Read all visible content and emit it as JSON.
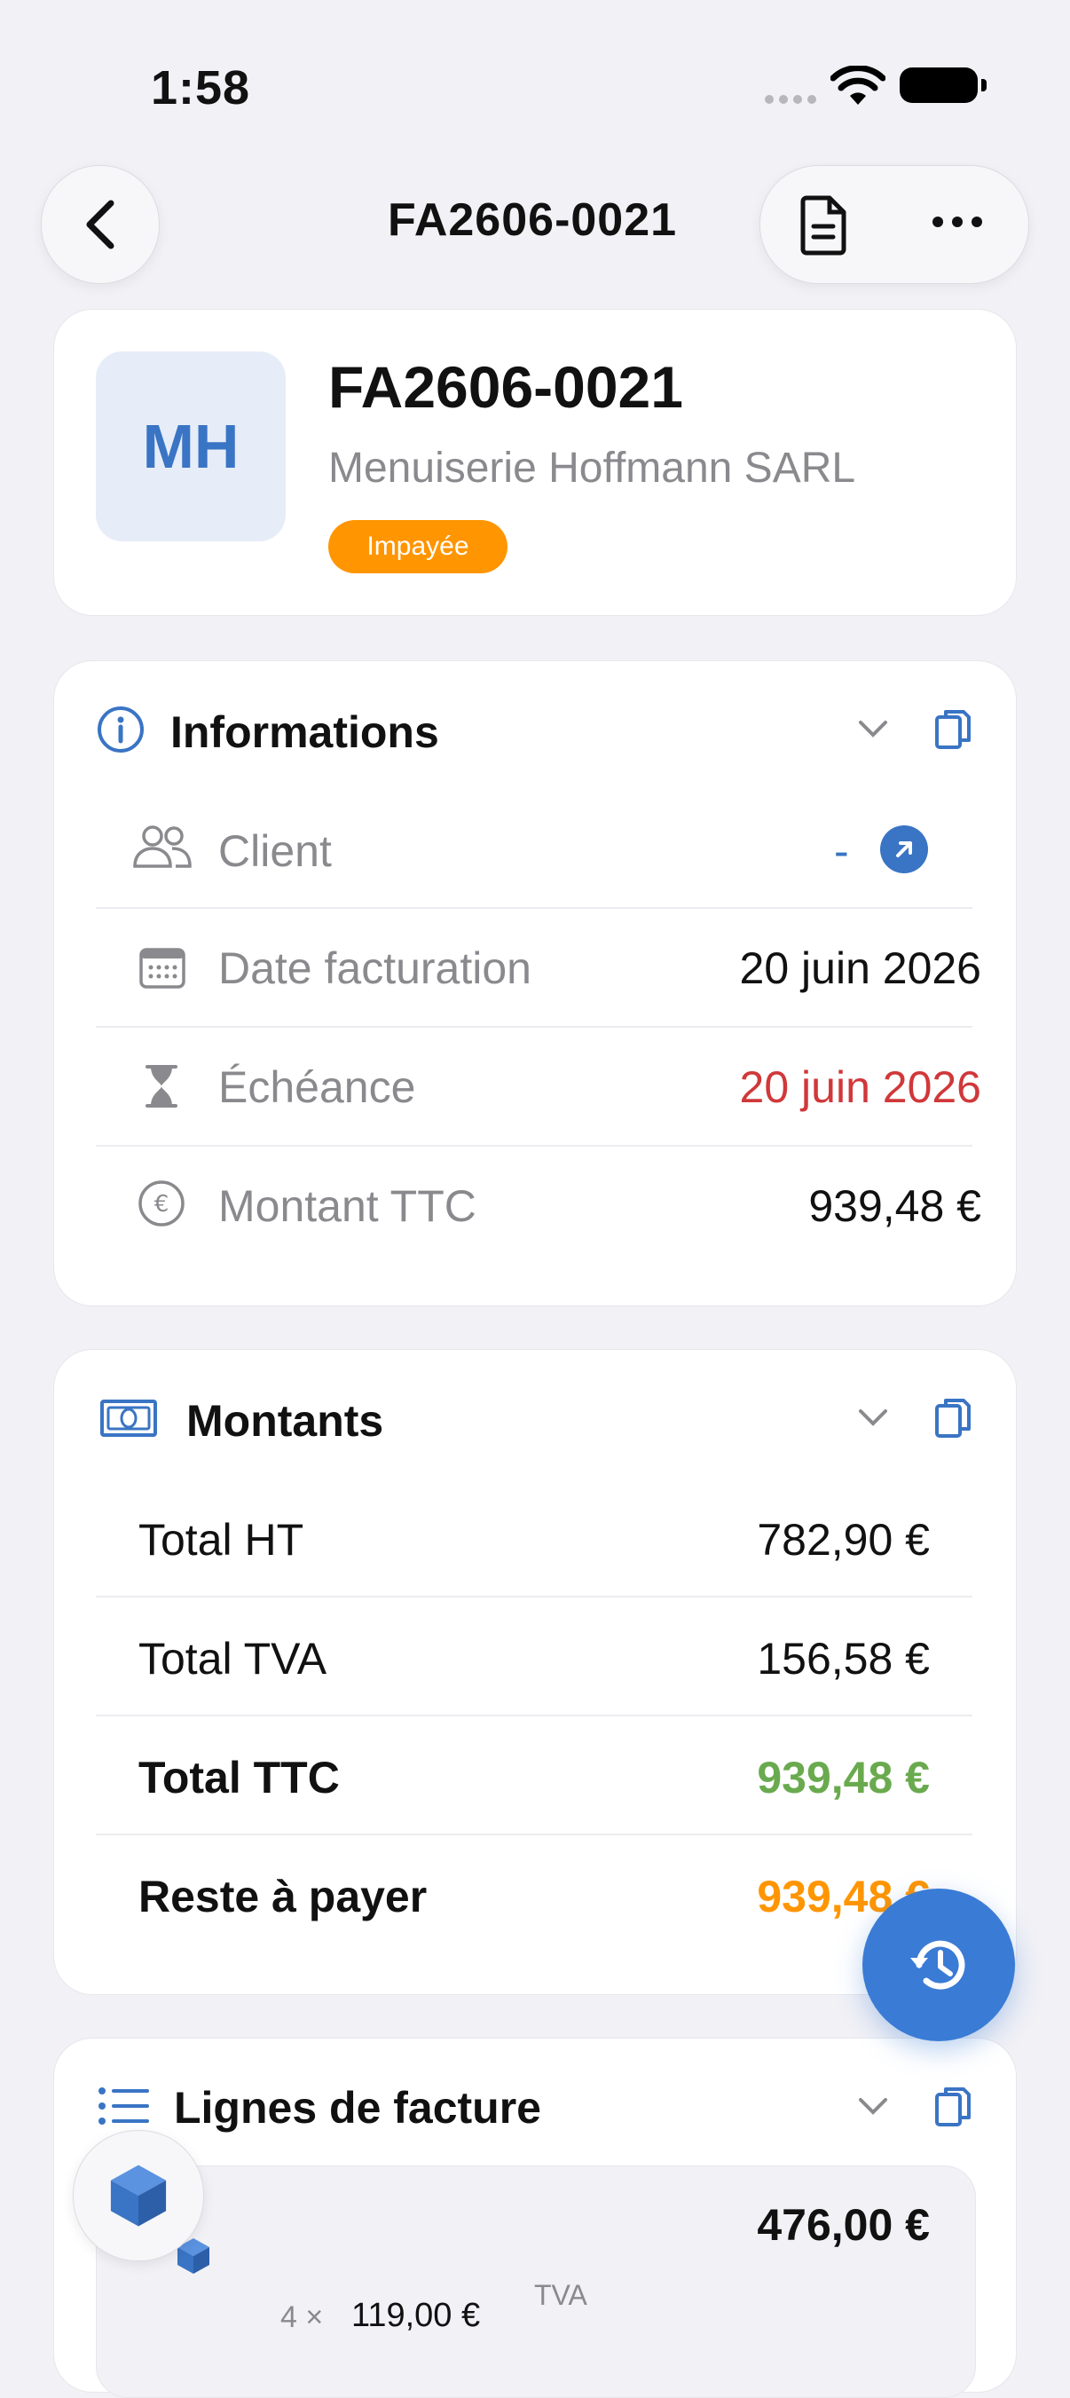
{
  "status_bar": {
    "time": "1:58"
  },
  "nav": {
    "title": "FA2606-0021"
  },
  "header": {
    "initials": "MH",
    "title": "FA2606-0021",
    "subtitle": "Menuiserie Hoffmann SARL",
    "badge": "Impayée",
    "badge_color": "#ff9500"
  },
  "info": {
    "title": "Informations",
    "rows": [
      {
        "icon": "people-icon",
        "label": "Client",
        "value": "-"
      },
      {
        "icon": "calendar-icon",
        "label": "Date facturation",
        "value": "20 juin 2026"
      },
      {
        "icon": "hourglass-icon",
        "label": "Échéance",
        "value": "20 juin 2026",
        "color": "#d0383a"
      },
      {
        "icon": "euro-icon",
        "label": "Montant TTC",
        "value": "939,48 €"
      }
    ]
  },
  "amounts": {
    "title": "Montants",
    "rows": [
      {
        "label": "Total HT",
        "value": "782,90 €"
      },
      {
        "label": "Total TVA",
        "value": "156,58 €"
      },
      {
        "label": "Total TTC",
        "value": "939,48 €",
        "color": "#6aaa4f"
      },
      {
        "label": "Reste à payer",
        "value": "939,48 €",
        "color": "#ff9500"
      }
    ]
  },
  "lines": {
    "title": "Lignes de facture",
    "items": [
      {
        "total": "476,00 €",
        "qty": "4 ×",
        "unit_price": "119,00 €",
        "tva_label": "TVA"
      }
    ]
  },
  "colors": {
    "accent": "#3a74c4",
    "background": "#f1f1f6"
  }
}
